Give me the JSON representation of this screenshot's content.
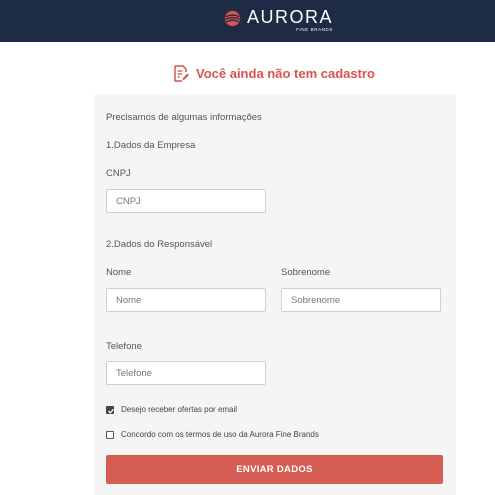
{
  "header": {
    "logo_name": "AURORA",
    "logo_sub": "FINE BRANDS",
    "bg_color": "#1d2b44",
    "logo_icon": "aurora-globe-icon"
  },
  "page": {
    "title": "Você ainda não tem cadastro",
    "title_icon": "document-edit-icon",
    "accent_color": "#d9534f"
  },
  "form": {
    "intro": "Precisamos de algumas informações",
    "section_company": "1.Dados da Empresa",
    "cnpj_label": "CNPJ",
    "cnpj_placeholder": "CNPJ",
    "section_responsible": "2.Dados do Responsável",
    "name_label": "Nome",
    "name_placeholder": "Nome",
    "surname_label": "Sobrenome",
    "surname_placeholder": "Sobrenome",
    "phone_label": "Telefone",
    "phone_placeholder": "Telefone",
    "offers_label": "Desejo receber ofertas por email",
    "offers_checked": true,
    "terms_label": "Concordo com os termos de uso da Aurora Fine Brands",
    "terms_checked": false,
    "submit_label": "ENVIAR DADOS",
    "submit_color": "#d65d54"
  }
}
